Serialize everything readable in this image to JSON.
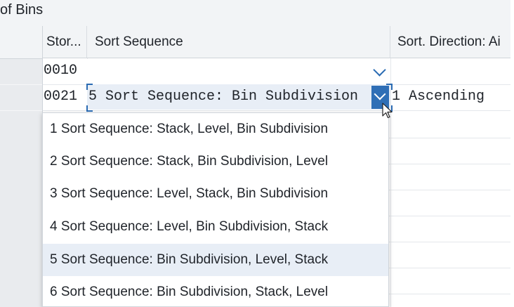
{
  "title": "of Bins",
  "columns": {
    "storage": "Stor...",
    "sort_sequence": "Sort Sequence",
    "sort_direction": "Sort. Direction: Ai"
  },
  "rows": [
    {
      "storage": "0010",
      "sort_sequence": "",
      "sort_direction": ""
    },
    {
      "storage": "0021",
      "sort_sequence": "5 Sort Sequence: Bin Subdivision",
      "sort_direction": "1 Ascending"
    }
  ],
  "dropdown": {
    "selected_index": 4,
    "options": [
      "1 Sort Sequence: Stack, Level, Bin Subdivision",
      "2 Sort Sequence: Stack, Bin Subdivision, Level",
      "3 Sort Sequence: Level, Stack, Bin Subdivision",
      "4 Sort Sequence: Level, Bin Subdivision, Stack",
      "5 Sort Sequence: Bin Subdivision, Level, Stack",
      "6 Sort Sequence: Bin Subdivision, Stack, Level"
    ]
  },
  "icons": {
    "combo_open": "chevron-down-icon",
    "pointer": "mouse-cursor-icon"
  },
  "colors": {
    "accent": "#2f6fb6",
    "selected_row": "#e8eef6",
    "header_bg": "#f2f4f6"
  }
}
